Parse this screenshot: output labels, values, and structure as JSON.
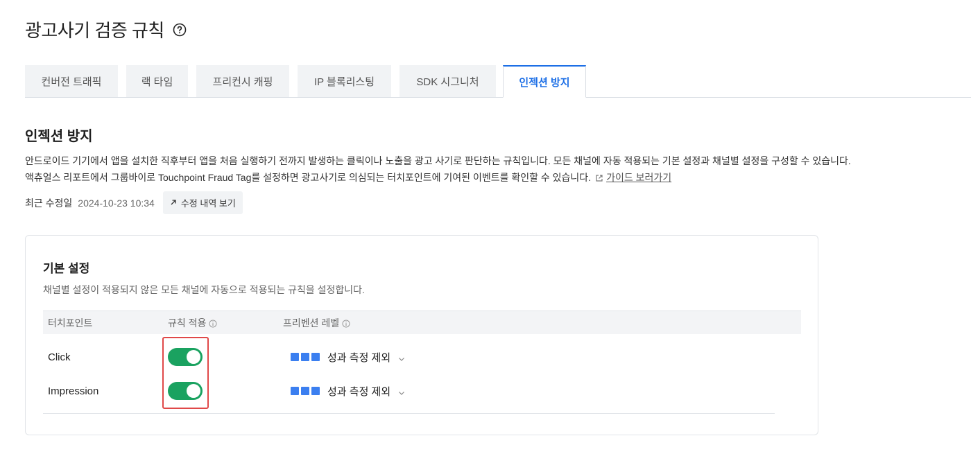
{
  "page": {
    "title": "광고사기 검증 규칙"
  },
  "tabs": [
    {
      "label": "컨버전 트래픽",
      "active": false
    },
    {
      "label": "랙 타임",
      "active": false
    },
    {
      "label": "프리컨시 캐핑",
      "active": false
    },
    {
      "label": "IP 블록리스팅",
      "active": false
    },
    {
      "label": "SDK 시그니처",
      "active": false
    },
    {
      "label": "인젝션 방지",
      "active": true
    }
  ],
  "section": {
    "title": "인젝션 방지",
    "desc1": "안드로이드 기기에서 앱을 설치한 직후부터 앱을 처음 실행하기 전까지 발생하는 클릭이나 노출을 광고 사기로 판단하는 규칙입니다. 모든 채널에 자동 적용되는 기본 설정과 채널별 설정을 구성할 수 있습니다.",
    "desc2": "액츄얼스 리포트에서 그룹바이로 Touchpoint Fraud Tag를 설정하면 광고사기로 의심되는 터치포인트에 기여된 이벤트를 확인할 수 있습니다.",
    "guide_link": "가이드 보러가기",
    "modified_label": "최근 수정일",
    "modified_date": "2024-10-23 10:34",
    "history_button": "수정 내역 보기"
  },
  "card": {
    "title": "기본 설정",
    "desc": "채널별 설정이 적용되지 않은 모든 채널에 자동으로 적용되는 규칙을 설정합니다.",
    "columns": {
      "touchpoint": "터치포인트",
      "rule": "규칙 적용",
      "level": "프리벤션 레벨"
    },
    "rows": [
      {
        "touchpoint": "Click",
        "enabled": true,
        "level_text": "성과 측정 제외",
        "level_value": 3
      },
      {
        "touchpoint": "Impression",
        "enabled": true,
        "level_text": "성과 측정 제외",
        "level_value": 3
      }
    ]
  },
  "colors": {
    "accent": "#1d6fe6",
    "toggle_on": "#1aa260",
    "level_blue": "#3b7ff0",
    "highlight": "#e04848"
  }
}
